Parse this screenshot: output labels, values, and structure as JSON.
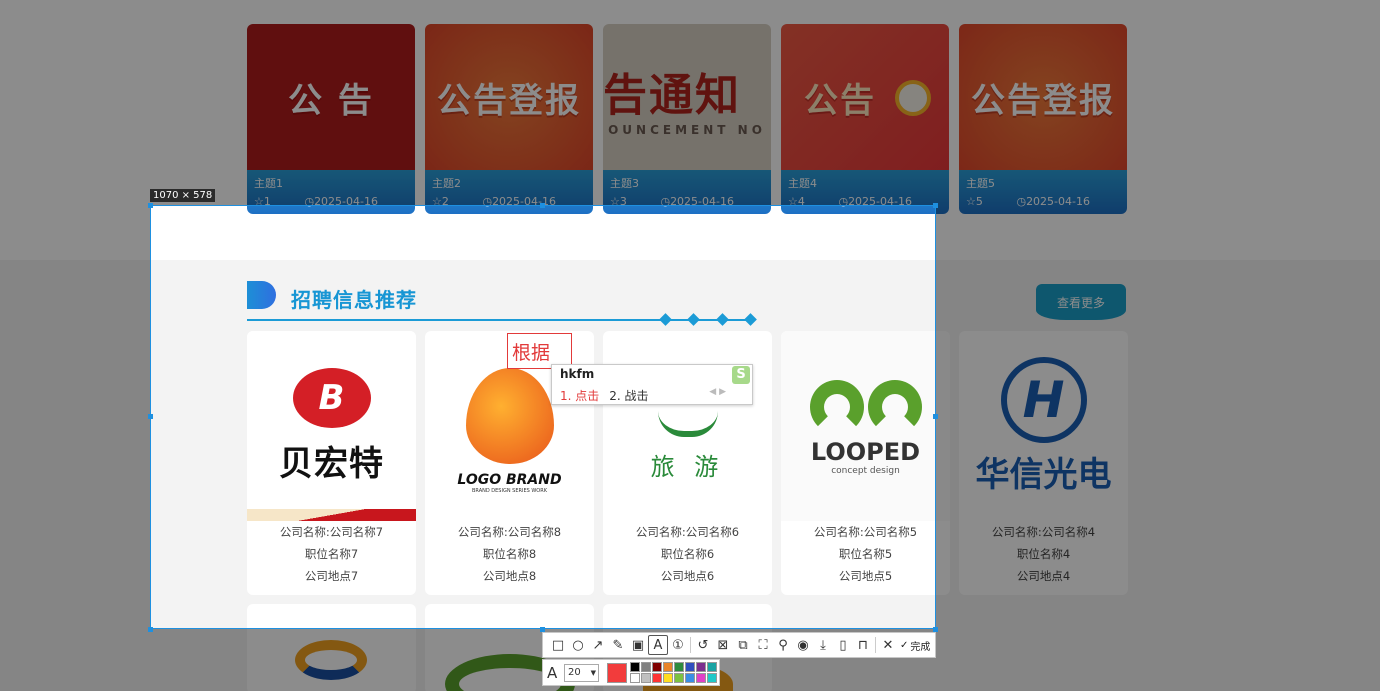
{
  "notices": [
    {
      "image_text": "公 告",
      "title": "主题1",
      "stars": "1",
      "date": "2025-04-16",
      "bg": "#b01c1c"
    },
    {
      "image_text": "公告登报",
      "title": "主题2",
      "stars": "2",
      "date": "2025-04-16",
      "bg": "#e8542a"
    },
    {
      "image_text": "告通知",
      "image_subtext": "OUNCEMENT NO",
      "title": "主题3",
      "stars": "3",
      "date": "2025-04-16",
      "bg": "#cfc6b8"
    },
    {
      "image_text": "公告",
      "title": "主题4",
      "stars": "4",
      "date": "2025-04-16",
      "bg": "#e8483a"
    },
    {
      "image_text": "公告登报",
      "title": "主题5",
      "stars": "5",
      "date": "2025-04-16",
      "bg": "#ea5530"
    }
  ],
  "section": {
    "title": "招聘信息推荐",
    "more_label": "查看更多"
  },
  "jobs": [
    {
      "logo_text": "贝宏特",
      "company": "公司名称:公司名称7",
      "position": "职位名称7",
      "location": "公司地点7"
    },
    {
      "logo_text": "LOGO BRAND",
      "logo_subtext": "BRAND DESIGN SERIES WORK",
      "company": "公司名称:公司名称8",
      "position": "职位名称8",
      "location": "公司地点8"
    },
    {
      "logo_text": "旅  游",
      "company": "公司名称:公司名称6",
      "position": "职位名称6",
      "location": "公司地点6"
    },
    {
      "logo_text": "LOOPED",
      "logo_subtext": "concept design",
      "company": "公司名称:公司名称5",
      "position": "职位名称5",
      "location": "公司地点5"
    },
    {
      "logo_text": "华信光电",
      "company": "公司名称:公司名称4",
      "position": "职位名称4",
      "location": "公司地点4"
    }
  ],
  "capture": {
    "size_label": "1070 × 578",
    "annotation_text": "根据",
    "ime": {
      "input": "hkfm",
      "candidates": [
        "1. 点击",
        "2. 战击"
      ]
    },
    "toolbar": {
      "tools": [
        "rectangle-icon",
        "ellipse-icon",
        "arrow-icon",
        "pen-icon",
        "mosaic-icon",
        "text-icon",
        "number-icon",
        "undo-icon",
        "ocr-icon",
        "translate-icon",
        "scroll-capture-icon",
        "pin-icon",
        "record-icon",
        "download-icon",
        "save-icon",
        "bookmark-icon"
      ],
      "cancel_icon": "close-icon",
      "done_label": "完成"
    },
    "font_size": "20",
    "current_color": "#f23c3c",
    "palette": [
      "#000000",
      "#808080",
      "#800000",
      "#e8842a",
      "#2e8b3e",
      "#2f4fbf",
      "#7b2f8f",
      "#1aa3a3",
      "#ffffff",
      "#c0c0c0",
      "#ff3333",
      "#ffdd22",
      "#7cc242",
      "#3a8ee6",
      "#e040c8",
      "#20c8c8"
    ]
  }
}
